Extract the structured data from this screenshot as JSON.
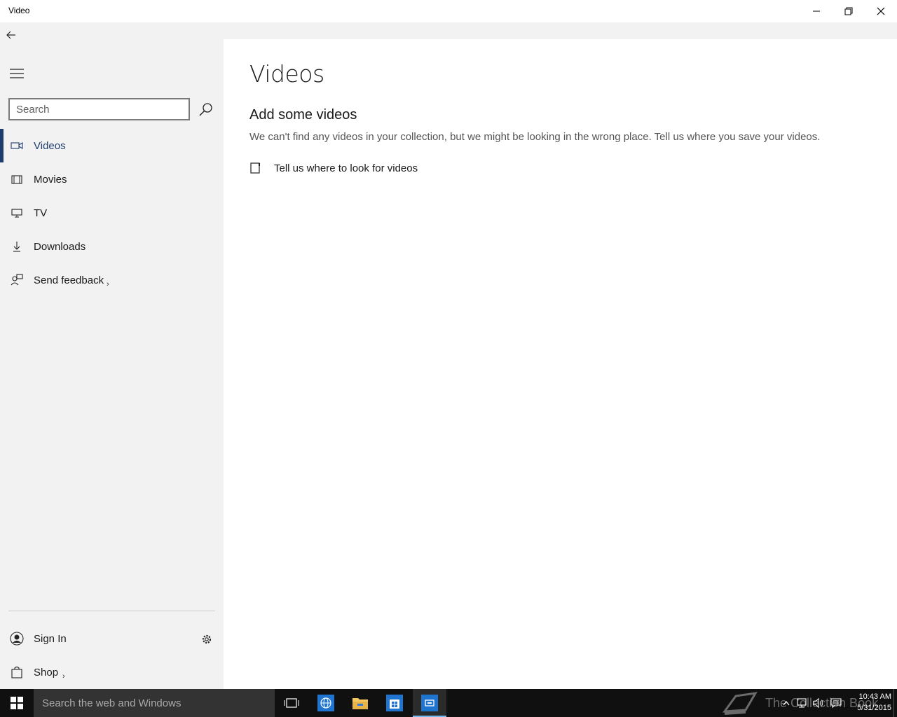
{
  "window": {
    "title": "Video"
  },
  "sidebar": {
    "search_placeholder": "Search",
    "items": [
      {
        "label": "Videos",
        "icon": "video-camera-icon",
        "active": true
      },
      {
        "label": "Movies",
        "icon": "film-icon"
      },
      {
        "label": "TV",
        "icon": "tv-icon"
      },
      {
        "label": "Downloads",
        "icon": "download-icon"
      },
      {
        "label": "Send feedback",
        "icon": "feedback-icon",
        "chevron": true
      }
    ],
    "signin_label": "Sign In",
    "shop_label": "Shop"
  },
  "main": {
    "title": "Videos",
    "heading": "Add some videos",
    "description": "We can't find any videos in your collection, but we might be looking in the wrong place. Tell us where you save your videos.",
    "link_label": "Tell us where to look for videos"
  },
  "taskbar": {
    "search_placeholder": "Search the web and Windows",
    "watermark": "The Collection Book",
    "time": "10:43 AM",
    "date": "5/31/2015"
  },
  "colors": {
    "accent": "#1f3c6e",
    "sidebar_bg": "#f2f2f2",
    "taskbar_bg": "#101010",
    "taskbar_highlight": "#76b9ed"
  }
}
